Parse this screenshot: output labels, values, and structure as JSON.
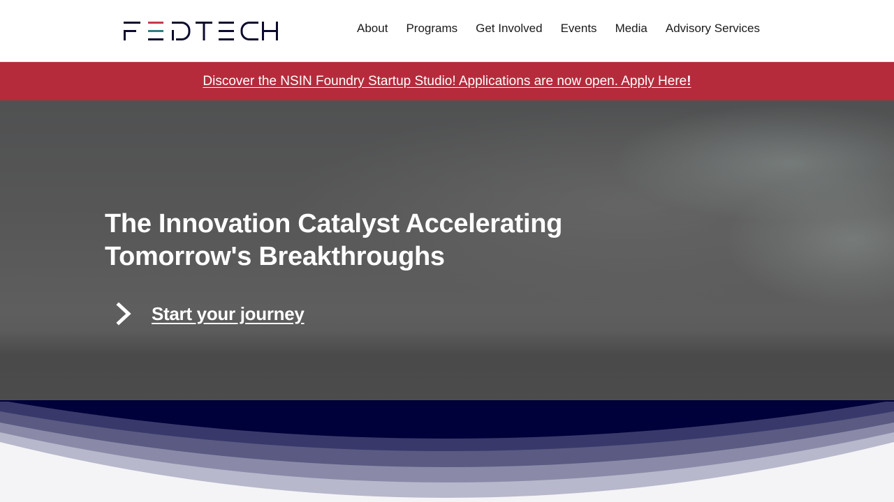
{
  "header": {
    "logo_text": "FEDTECH",
    "nav": [
      {
        "label": "About"
      },
      {
        "label": "Programs"
      },
      {
        "label": "Get Involved"
      },
      {
        "label": "Events"
      },
      {
        "label": "Media"
      },
      {
        "label": "Advisory Services"
      }
    ]
  },
  "banner": {
    "text": "Discover the NSIN Foundry Startup Studio! Applications are now open. Apply Here",
    "emphasis": "!",
    "background": "#b52b3c"
  },
  "hero": {
    "title_line1": "The Innovation Catalyst Accelerating",
    "title_line2": "Tomorrow's Breakthroughs",
    "cta_label": "Start your journey",
    "cta_icon": "chevron-right-icon"
  },
  "colors": {
    "brand_navy": "#00003a",
    "brand_teal": "#2f7f86",
    "brand_red": "#b52b3c"
  }
}
